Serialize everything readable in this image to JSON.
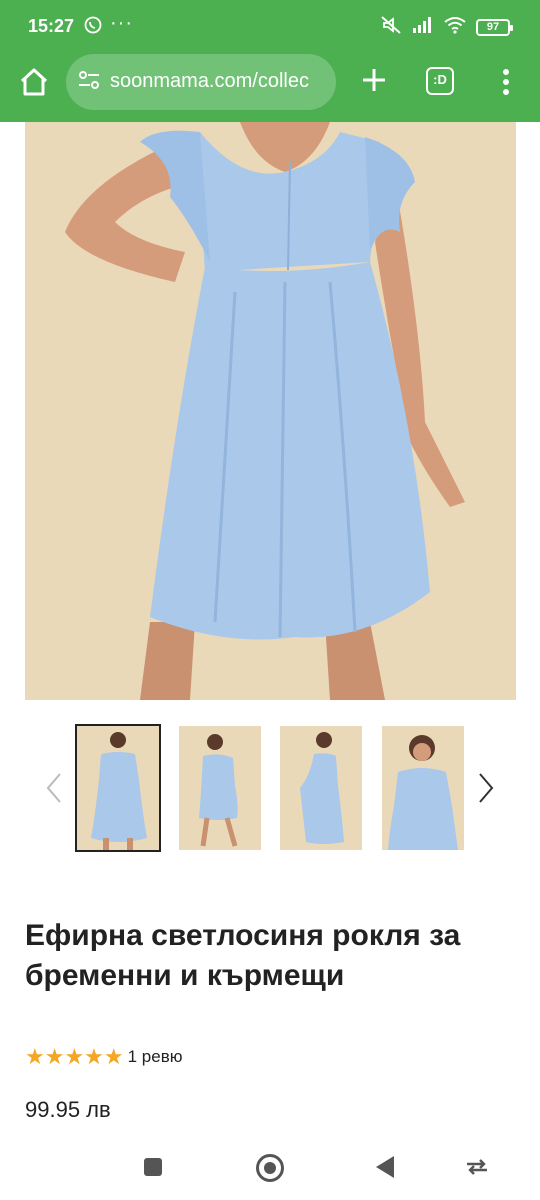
{
  "status": {
    "time": "15:27",
    "battery": "97"
  },
  "browser": {
    "url": "soonmama.com/collec",
    "tab_label": ":D"
  },
  "product": {
    "title": "Ефирна светлосиня рокля за бременни и кърмещи",
    "stars": "★★★★★",
    "reviews": "1 ревю",
    "price": "99.95 лв"
  },
  "icons": {
    "home": "home-icon",
    "site_settings": "tune-icon",
    "new_tab": "plus-icon",
    "tabs": "tab-switcher-icon",
    "menu": "more-vert-icon",
    "prev": "chevron-left-icon",
    "next": "chevron-right-icon"
  },
  "colors": {
    "chrome_green": "#4caf50",
    "star": "#f5a623",
    "dress": "#a9c8ea",
    "background": "#ead9b8"
  }
}
